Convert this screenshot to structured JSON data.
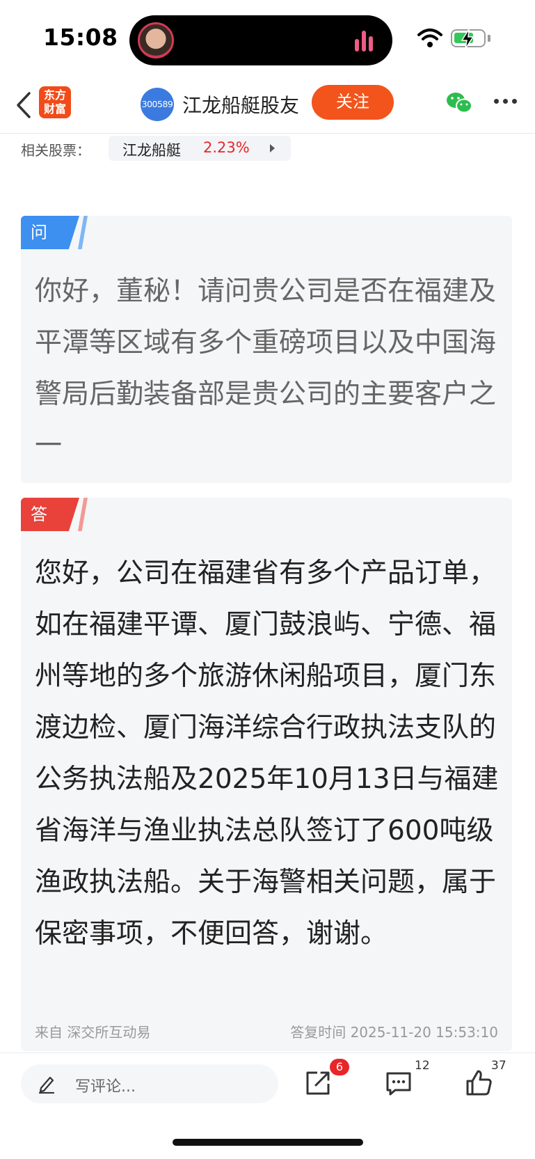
{
  "status_bar": {
    "time": "15:08"
  },
  "nav": {
    "logo_line1": "东方",
    "logo_line2": "财富",
    "stock_code": "300589",
    "group_name": "江龙船艇股友",
    "follow_label": "关注"
  },
  "related": {
    "label": "相关股票：",
    "stock_name": "江龙船艇",
    "change_pct": "2.23%"
  },
  "question": {
    "tag": "问",
    "text": "你好，董秘！请问贵公司是否在福建及平潭等区域有多个重磅项目以及中国海警局后勤装备部是贵公司的主要客户之一"
  },
  "answer": {
    "tag": "答",
    "text": "您好，公司在福建省有多个产品订单，如在福建平谭、厦门鼓浪屿、宁德、福州等地的多个旅游休闲船项目，厦门东渡边检、厦门海洋综合行政执法支队的公务执法船及2025年10月13日与福建省海洋与渔业执法总队签订了600吨级渔政执法船。关于海警相关问题，属于保密事项，不便回答，谢谢。",
    "source": "来自 深交所互动易",
    "reply_time": "答复时间 2025-11-20 15:53:10"
  },
  "bottom_bar": {
    "comment_placeholder": "写评论...",
    "share_badge": "6",
    "comment_count": "12",
    "like_count": "37"
  },
  "colors": {
    "accent_orange": "#f2541b",
    "question_blue": "#3d8ff0",
    "answer_red": "#e8423b",
    "rise_red": "#e8262a"
  },
  "icons": [
    "back-icon",
    "wifi-icon",
    "battery-icon",
    "wechat-icon",
    "more-icon",
    "pen-icon",
    "share-icon",
    "comments-icon",
    "like-icon"
  ]
}
